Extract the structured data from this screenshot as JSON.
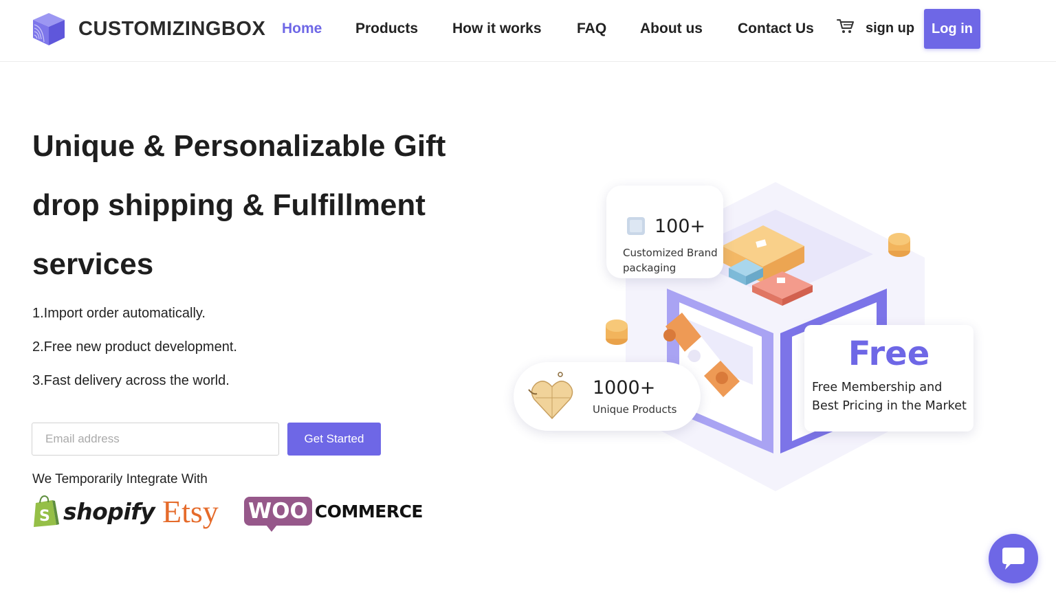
{
  "brand": {
    "name": "CUSTOMIZINGBOX",
    "accent": "#6e67e6"
  },
  "nav": {
    "items": [
      {
        "label": "Home",
        "active": true
      },
      {
        "label": "Products"
      },
      {
        "label": "How it works"
      },
      {
        "label": "FAQ"
      },
      {
        "label": "About us"
      },
      {
        "label": "Contact Us"
      }
    ],
    "cart_icon": "cart-icon",
    "signup_label": "sign up",
    "login_label": "Log in"
  },
  "hero": {
    "title_lines": [
      "Unique & Personalizable Gift",
      "drop shipping & Fulfillment",
      "services"
    ],
    "features": [
      "1.Import order automatically.",
      "2.Free new product development.",
      "3.Fast delivery across the world."
    ],
    "email_placeholder": "Email address",
    "cta_label": "Get Started",
    "integrate_label": "We Temporarily Integrate With",
    "integrations": {
      "shopify": "shopify",
      "etsy": "Etsy",
      "woo": "WOO",
      "commerce": "COMMERCE"
    }
  },
  "stats": {
    "packaging": {
      "number": "100+",
      "desc_line1": "Customized Brand",
      "desc_line2": "packaging",
      "icon": "box-icon"
    },
    "products": {
      "number": "1000+",
      "desc": "Unique Products",
      "icon": "heart-puzzle-icon"
    },
    "free": {
      "title": "Free",
      "desc_line1": "Free Membership and",
      "desc_line2": "Best Pricing in the Market"
    }
  },
  "chat": {
    "icon": "chat-icon"
  }
}
